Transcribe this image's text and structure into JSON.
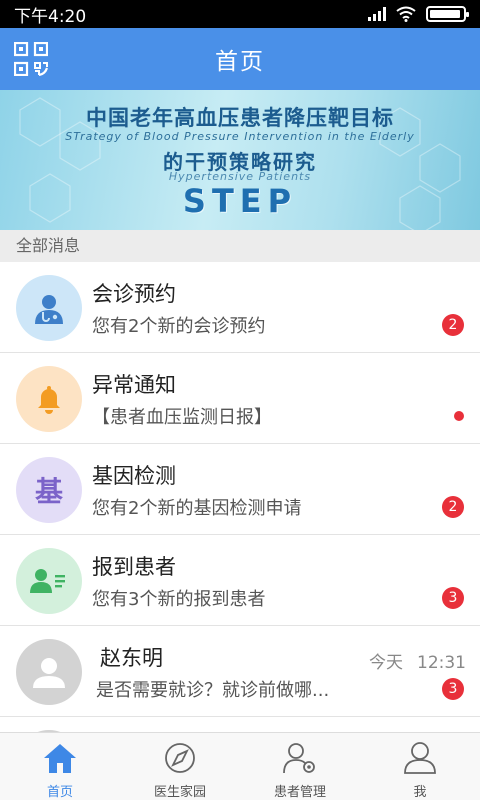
{
  "status": {
    "time": "下午4:20"
  },
  "header": {
    "title": "首页"
  },
  "banner": {
    "line1": "中国老年高血压患者降压靶目标",
    "sub1": "STrategy of Blood Pressure Intervention in the Elderly",
    "line2": "的干预策略研究",
    "sub2": "Hypertensive Patients",
    "acronym": "STEP"
  },
  "section": {
    "label": "全部消息"
  },
  "messages": [
    {
      "title": "会诊预约",
      "subtitle": "您有2个新的会诊预约",
      "badge": "2",
      "avatar_bg": "#cde6f8",
      "icon": "doctor-icon"
    },
    {
      "title": "异常通知",
      "subtitle": "【患者血压监测日报】",
      "badge": "",
      "avatar_bg": "#fde3c4",
      "icon": "bell-icon"
    },
    {
      "title": "基因检测",
      "subtitle": "您有2个新的基因检测申请",
      "badge": "2",
      "avatar_bg": "#e3ddf7",
      "icon_text": "基",
      "icon": "gene-icon"
    },
    {
      "title": "报到患者",
      "subtitle": "您有3个新的报到患者",
      "badge": "3",
      "avatar_bg": "#d3f0dc",
      "icon": "patient-card-icon"
    },
    {
      "title": "赵东明",
      "subtitle": "是否需要就诊？就诊前做哪...",
      "badge": "3",
      "date": "今天",
      "time": "12:31",
      "avatar_bg": "#d3d3d3",
      "icon": "user-avatar-icon"
    }
  ],
  "tabs": [
    {
      "label": "首页",
      "icon": "home-icon",
      "active": true
    },
    {
      "label": "医生家园",
      "icon": "compass-icon",
      "active": false
    },
    {
      "label": "患者管理",
      "icon": "patient-settings-icon",
      "active": false
    },
    {
      "label": "我",
      "icon": "person-icon",
      "active": false
    }
  ],
  "colors": {
    "primary": "#4a90e8",
    "badge": "#e8303a",
    "active_tab": "#3e88e6"
  }
}
